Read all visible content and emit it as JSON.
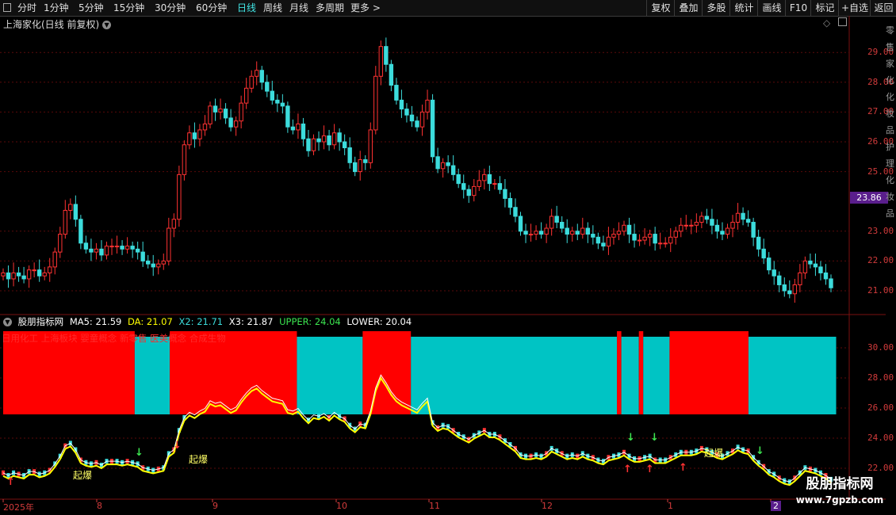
{
  "toolbar": {
    "periods": [
      "分时",
      "1分钟",
      "5分钟",
      "15分钟",
      "30分钟",
      "60分钟",
      "日线",
      "周线",
      "月线",
      "多周期",
      "更多 >"
    ],
    "active_period": "日线",
    "right_buttons": [
      "复权",
      "叠加",
      "多股",
      "统计",
      "画线",
      "F10",
      "标记",
      "+自选",
      "返回"
    ]
  },
  "main_pane": {
    "title": "上海家化(日线 前复权)",
    "current_price": "23.86",
    "y_ticks": [
      "29.00",
      "28.00",
      "27.00",
      "26.00",
      "25.00",
      "23.00",
      "22.00",
      "21.00"
    ]
  },
  "indicator": {
    "name": "股朋指标网",
    "ma5_label": "MA5: 21.59",
    "da_label": "DA: 21.07",
    "x2_label": "X2: 21.71",
    "x3_label": "X3: 21.87",
    "upper_label": "UPPER: 24.04",
    "lower_label": "LOWER: 20.04",
    "blocks_text": "日用化工 上海板块 婴童概念 新零售 医美概念 合成生物",
    "y_ticks": [
      "30.00",
      "28.00",
      "26.00",
      "24.00",
      "22.00"
    ],
    "signal_labels": [
      "起爆",
      "起爆",
      "起爆"
    ]
  },
  "x_axis": [
    "2025年",
    "8",
    "9",
    "10",
    "11",
    "12",
    "1",
    "2"
  ],
  "side_text": "零售家化化妆品护理化妆品",
  "watermark": {
    "line1": "股朋指标网",
    "line2": "www.7gpzb.com"
  },
  "colors": {
    "up": "#ff3232",
    "down": "#3cdcdc",
    "ma": "#ffff00",
    "grid": "#5a0a0a",
    "text": "#d23b3b",
    "active": "#42e6e6"
  },
  "chart_data": {
    "type": "candlestick",
    "x_ticks": [
      "2025年",
      "8",
      "9",
      "10",
      "11",
      "12",
      "1",
      "2"
    ],
    "y_ticks": [
      21,
      22,
      23,
      25,
      26,
      27,
      28,
      29
    ],
    "ylim": [
      20.6,
      29.9
    ],
    "current_price": 23.86,
    "close": [
      21.6,
      21.4,
      21.6,
      21.5,
      21.4,
      21.7,
      21.7,
      21.5,
      21.6,
      21.8,
      22.3,
      22.9,
      23.7,
      23.9,
      23.4,
      22.6,
      22.4,
      22.3,
      22.4,
      22.2,
      22.5,
      22.5,
      22.5,
      22.4,
      22.5,
      22.4,
      22.3,
      22.0,
      21.9,
      21.8,
      21.9,
      22.0,
      23.1,
      23.4,
      24.9,
      25.9,
      26.3,
      26.1,
      26.4,
      26.6,
      27.2,
      27.0,
      27.1,
      26.8,
      26.5,
      26.7,
      27.3,
      27.8,
      28.2,
      28.4,
      28.0,
      27.7,
      27.4,
      27.3,
      27.2,
      26.5,
      26.4,
      26.6,
      26.1,
      25.7,
      26.1,
      26.0,
      26.2,
      25.9,
      26.3,
      26.0,
      25.8,
      25.3,
      25.0,
      25.4,
      25.3,
      26.4,
      28.2,
      29.2,
      28.6,
      27.9,
      27.4,
      27.1,
      26.9,
      26.7,
      26.5,
      27.0,
      27.4,
      25.5,
      25.1,
      25.3,
      25.2,
      24.9,
      24.6,
      24.4,
      24.2,
      24.5,
      24.7,
      24.9,
      24.6,
      24.6,
      24.4,
      24.1,
      23.8,
      23.5,
      23.0,
      22.9,
      22.9,
      23.0,
      22.9,
      23.1,
      23.5,
      23.3,
      23.1,
      22.9,
      23.0,
      22.9,
      23.1,
      22.9,
      22.8,
      22.6,
      22.5,
      22.8,
      22.9,
      23.0,
      23.2,
      22.9,
      22.7,
      22.7,
      22.8,
      22.9,
      22.6,
      22.6,
      22.6,
      22.8,
      23.0,
      23.2,
      23.2,
      23.2,
      23.3,
      23.5,
      23.4,
      23.2,
      23.0,
      22.9,
      23.1,
      23.3,
      23.6,
      23.4,
      23.3,
      22.8,
      22.4,
      22.1,
      21.7,
      21.5,
      21.2,
      21.0,
      20.9,
      21.2,
      21.6,
      22.0,
      21.9,
      21.8,
      21.6,
      21.4,
      21.1
    ]
  }
}
